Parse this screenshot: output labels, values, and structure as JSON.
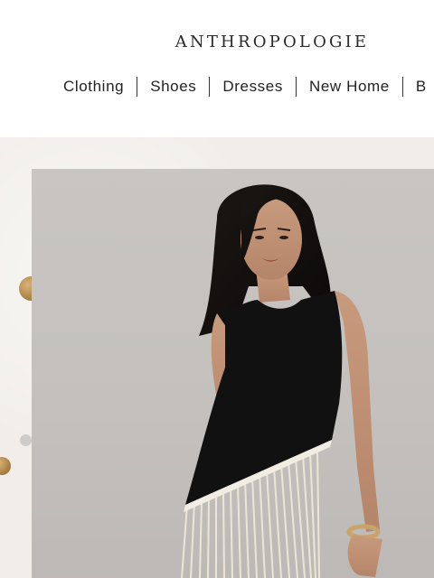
{
  "brand": {
    "name": "ANTHROPOLOGIE"
  },
  "nav": {
    "items": [
      "Clothing",
      "Shoes",
      "Dresses",
      "New Home",
      "B"
    ]
  },
  "hero": {
    "image_alt": "Model wearing black sleeveless dress with white fringe hem",
    "colors": {
      "backdrop": "#f1eeea",
      "photo_bg": "#c6c3c0",
      "dress": "#111111",
      "fringe": "#ece6d8",
      "confetti_gold": "#b08748"
    }
  }
}
